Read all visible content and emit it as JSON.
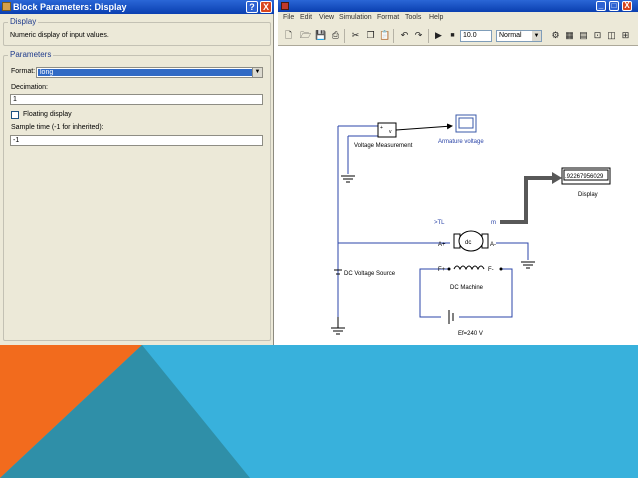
{
  "dialog": {
    "title": "Block Parameters: Display",
    "help_button": "?",
    "close_button": "X",
    "description_group": "Display",
    "description": "Numeric display of input values.",
    "parameters_group": "Parameters",
    "format_label": "Format:",
    "format_value": "long",
    "decimation_label": "Decimation:",
    "decimation_value": "1",
    "floating_label": "Floating display",
    "floating_checked": false,
    "sample_time_label": "Sample time (-1 for inherited):",
    "sample_time_value": "-1"
  },
  "simulink": {
    "window_controls": [
      "_",
      "□",
      "X"
    ],
    "menu": [
      "File",
      "Edit",
      "View",
      "Simulation",
      "Format",
      "Tools",
      "Help"
    ],
    "stop_time": "10.0",
    "sim_mode": "Normal",
    "stop_glyph": "■",
    "blocks": {
      "voltage_measurement": "Voltage Measurement",
      "voltage_measurement_in": "v",
      "voltage_measurement_out": "+",
      "armature_voltage": "Armature voltage",
      "display_value": ".92267956029",
      "display_label": "Display",
      "dc_source": "DC Voltage Source",
      "dc_machine": "DC Machine",
      "dc_machine_inner": "dc",
      "tl_port": ">TL",
      "m_port": "m",
      "a_plus": "A+",
      "a_minus": "A-",
      "f_plus": "F+",
      "f_minus": "F-",
      "field_source": "Ef=240 V"
    }
  },
  "colors": {
    "slide_blue": "#38b1dc",
    "slide_orange": "#f26b1d",
    "slide_teal": "#2f8fa8",
    "wire_blue": "#2b45a8",
    "thick_signal": "#585858"
  }
}
